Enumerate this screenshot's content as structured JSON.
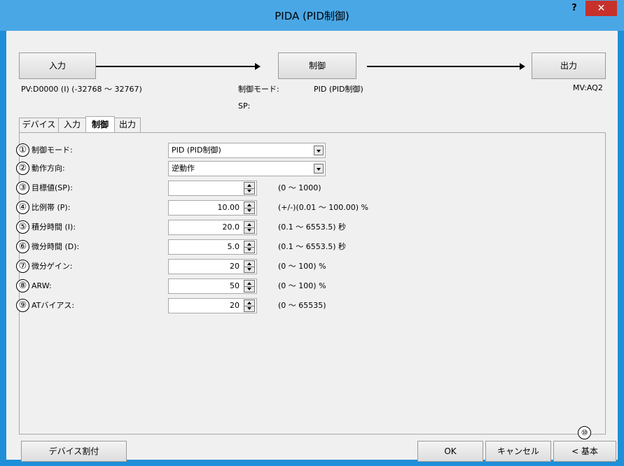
{
  "window": {
    "title": "PIDA (PID制御)",
    "help": "?",
    "close": "✕"
  },
  "flow": {
    "input_button": "入力",
    "control_button": "制御",
    "output_button": "出力",
    "pv_text": "PV:D0000 (I) (-32768 ～ 32767)",
    "mode_label": "制御モード:",
    "mode_value": "PID (PID制御)",
    "sp_label": "SP:",
    "mv_text": "MV:AQ2"
  },
  "tabs": [
    {
      "label": "デバイス",
      "active": false
    },
    {
      "label": "入力",
      "active": false
    },
    {
      "label": "制御",
      "active": true
    },
    {
      "label": "出力",
      "active": false
    }
  ],
  "rows": [
    {
      "num": "①",
      "label": "制御モード:",
      "type": "combo",
      "value": "PID (PID制御)"
    },
    {
      "num": "②",
      "label": "動作方向:",
      "type": "combo",
      "value": "逆動作"
    },
    {
      "num": "③",
      "label": "目標値(SP):",
      "type": "spin",
      "value": "",
      "range": "(0 ～ 1000)"
    },
    {
      "num": "④",
      "label": "比例帯 (P):",
      "type": "spin",
      "value": "10.00",
      "range": "(+/-)(0.01 ～ 100.00) %"
    },
    {
      "num": "⑤",
      "label": "積分時間 (I):",
      "type": "spin",
      "value": "20.0",
      "range": "(0.1 ～ 6553.5) 秒"
    },
    {
      "num": "⑥",
      "label": "微分時間 (D):",
      "type": "spin",
      "value": "5.0",
      "range": "(0.1 ～ 6553.5) 秒"
    },
    {
      "num": "⑦",
      "label": "微分ゲイン:",
      "type": "spin",
      "value": "20",
      "range": "(0 ～ 100) %"
    },
    {
      "num": "⑧",
      "label": "ARW:",
      "type": "spin",
      "value": "50",
      "range": "(0 ～ 100) %"
    },
    {
      "num": "⑨",
      "label": "ATバイアス:",
      "type": "spin",
      "value": "20",
      "range": "(0 ～ 65535)"
    }
  ],
  "footer": {
    "device_assign": "デバイス割付",
    "ok": "OK",
    "cancel": "キャンセル",
    "basic": "< 基本",
    "marker": "⑩"
  }
}
